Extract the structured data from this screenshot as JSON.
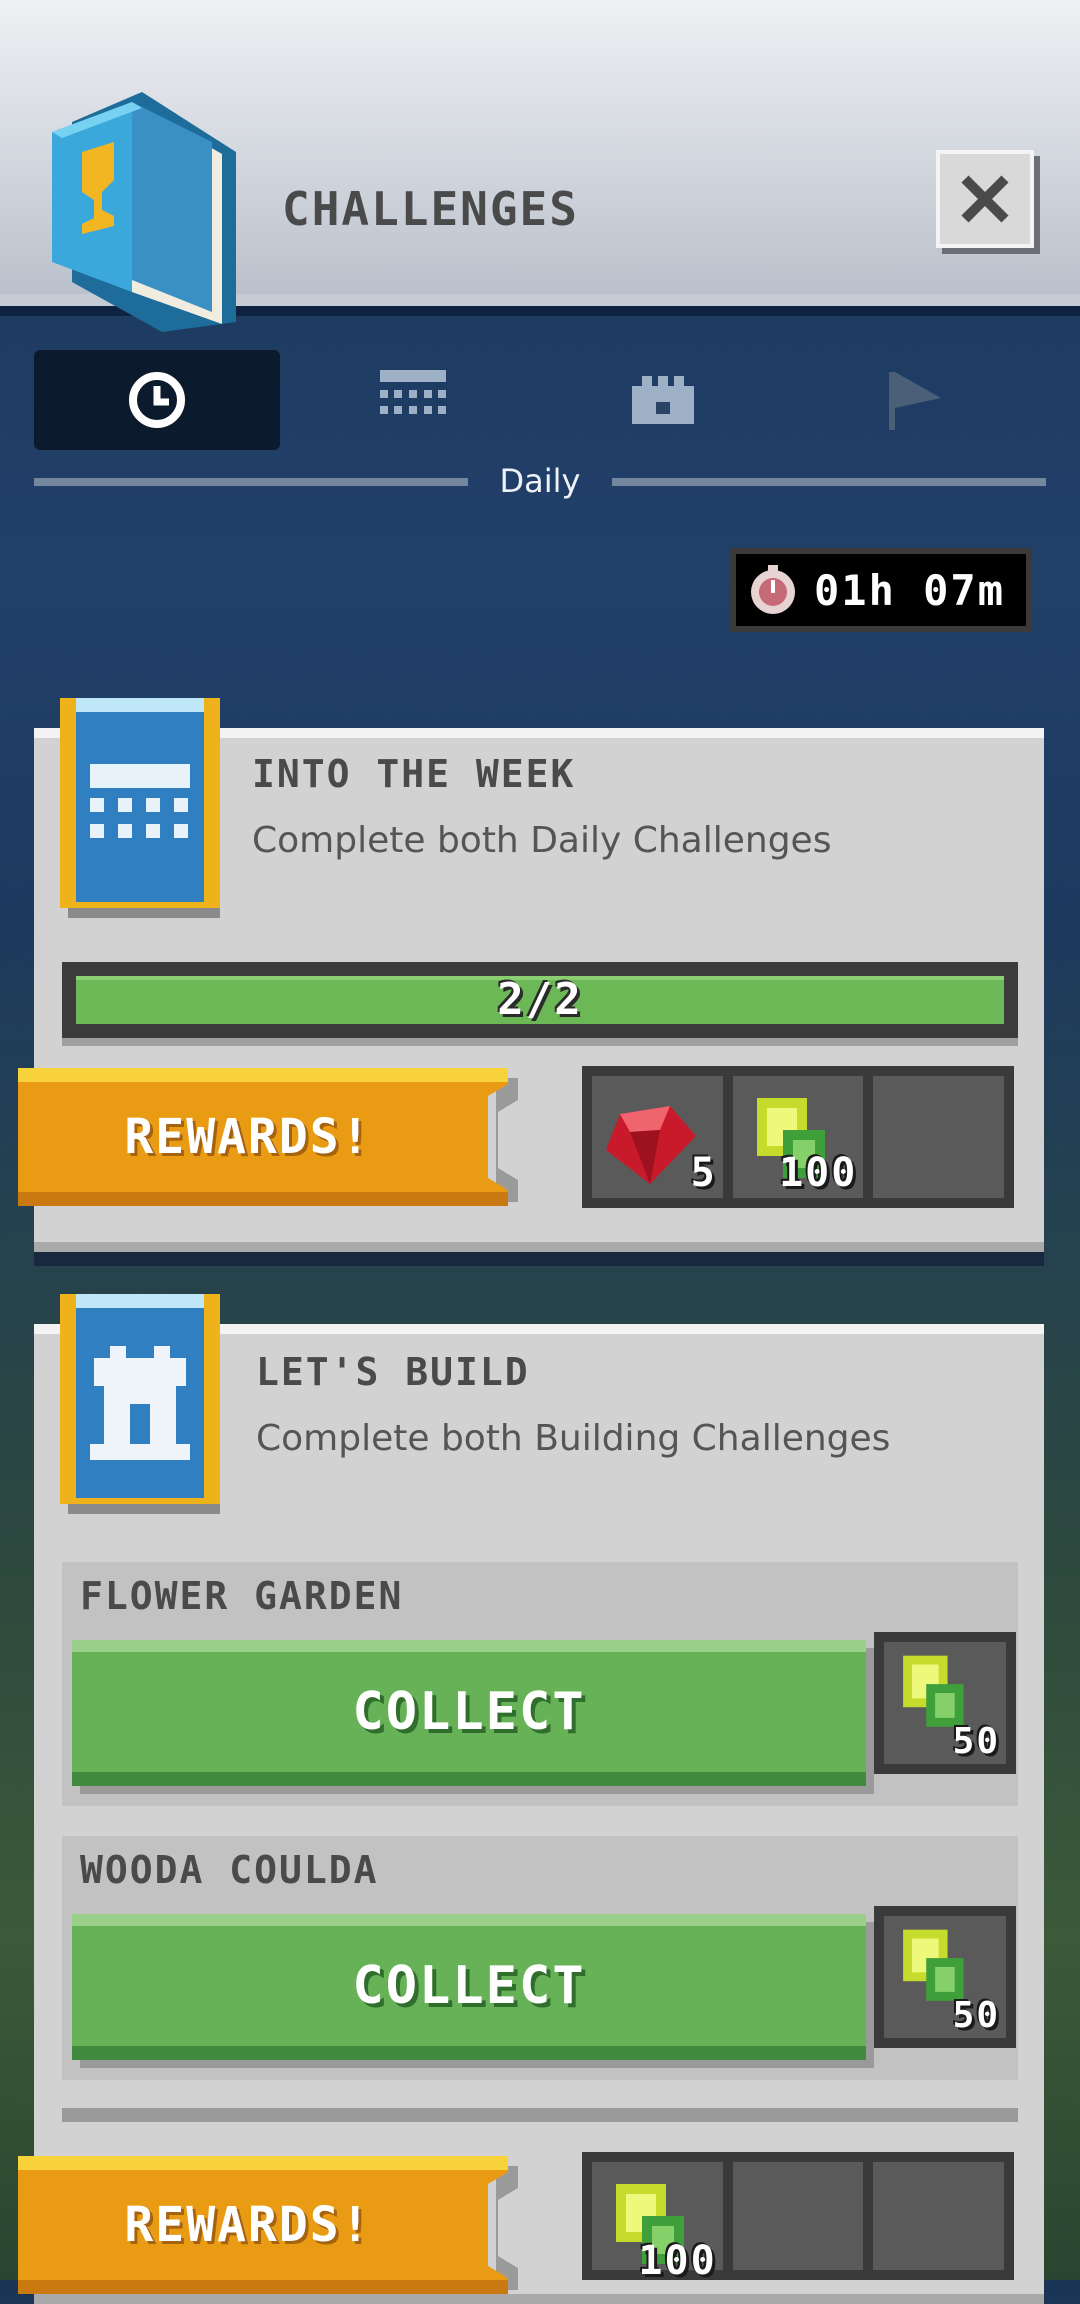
{
  "header": {
    "title": "CHALLENGES"
  },
  "tabs": {
    "items": [
      {
        "icon": "clock-icon",
        "active": true
      },
      {
        "icon": "calendar-icon",
        "active": false
      },
      {
        "icon": "castle-icon",
        "active": false
      },
      {
        "icon": "flag-icon",
        "active": false
      }
    ],
    "caption": "Daily"
  },
  "timer": {
    "text": "01h 07m"
  },
  "challenges": [
    {
      "title": "INTO THE WEEK",
      "description": "Complete both Daily Challenges",
      "progress": {
        "label": "2/2",
        "fraction": 1.0
      },
      "rewards_label": "REWARDS!",
      "rewards": [
        {
          "icon": "ruby-gem-icon",
          "count": "5"
        },
        {
          "icon": "emerald-coin-icon",
          "count": "100"
        },
        {
          "icon": "",
          "count": ""
        }
      ]
    },
    {
      "title": "LET'S BUILD",
      "description": "Complete both Building Challenges",
      "subchallenges": [
        {
          "title": "FLOWER GARDEN",
          "button": "COLLECT",
          "reward_icon": "emerald-coin-icon",
          "reward_count": "50"
        },
        {
          "title": "WOODA COULDA",
          "button": "COLLECT",
          "reward_icon": "emerald-coin-icon",
          "reward_count": "50"
        }
      ],
      "rewards_label": "REWARDS!",
      "rewards": [
        {
          "icon": "emerald-coin-icon",
          "count": "100"
        },
        {
          "icon": "",
          "count": ""
        },
        {
          "icon": "",
          "count": ""
        }
      ]
    }
  ],
  "colors": {
    "accent_green": "#6cb856",
    "rewards_gold": "#f0b21a",
    "banner_blue": "#2f7fc1"
  }
}
